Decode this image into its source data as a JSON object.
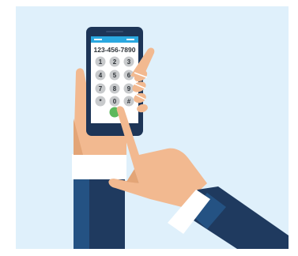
{
  "phone": {
    "dialed_number": "123-456-7890",
    "keypad": [
      [
        "1",
        "2",
        "3"
      ],
      [
        "4",
        "5",
        "6"
      ],
      [
        "7",
        "8",
        "9"
      ],
      [
        "*",
        "0",
        "#"
      ]
    ]
  },
  "colors": {
    "background": "#dff0fb",
    "phone_body": "#1d3557",
    "screen": "#ffffff",
    "status_bar": "#2aa8e0",
    "key": "#c8cacc",
    "call_button": "#5cb85c",
    "skin": "#f2b990",
    "skin_shadow": "#e3a577",
    "sleeve": "#1f3a5f",
    "sleeve_light": "#245283",
    "cuff": "#ffffff"
  }
}
